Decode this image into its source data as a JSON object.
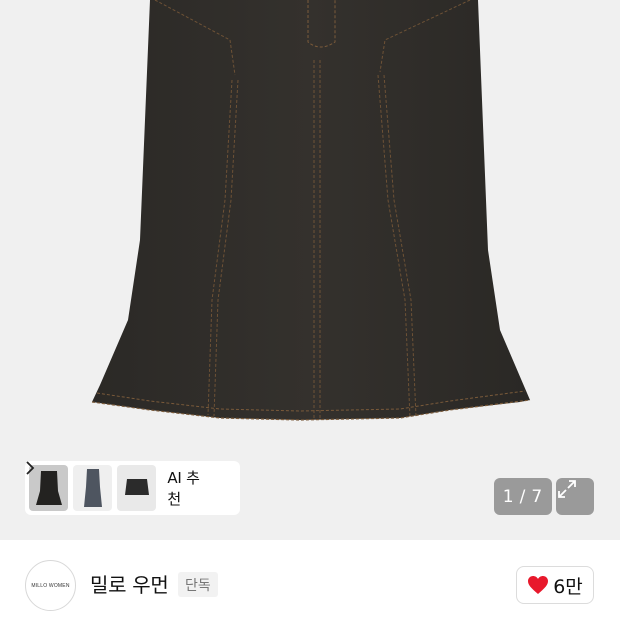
{
  "gallery": {
    "current_page": "1",
    "separator": "/",
    "total_pages": "7",
    "expand_icon": "expand-icon"
  },
  "recommendation": {
    "label": "AI 추천",
    "thumbnails": [
      "skirt-thumb-black-midi",
      "skirt-thumb-grey-long",
      "skirt-thumb-black-mini"
    ],
    "chevron_icon": "chevron-right-icon"
  },
  "brand": {
    "logo_text": "MILLO WOMEN",
    "name": "밀로 우먼",
    "badge": "단독"
  },
  "like": {
    "icon": "heart-icon",
    "count": "6만",
    "heart_color": "#e8192c"
  }
}
